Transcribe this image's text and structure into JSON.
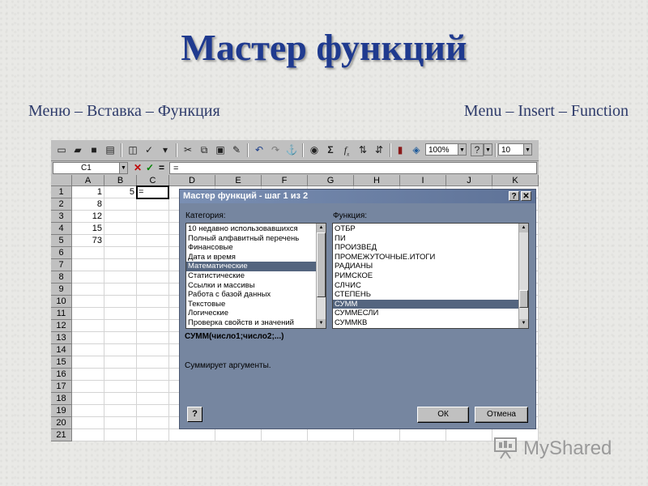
{
  "slide": {
    "title": "Мастер функций",
    "subtitle_ru": "Меню – Вставка – Функция",
    "subtitle_en": "Menu – Insert – Function"
  },
  "excel": {
    "toolbar": {
      "zoom": "100%",
      "font_size": "10",
      "icons": [
        "new-icon",
        "open-icon",
        "save-icon",
        "print-icon",
        "print-preview-icon",
        "spelling-icon",
        "cut-icon",
        "copy-icon",
        "paste-icon",
        "format-painter-icon",
        "undo-icon",
        "redo-icon",
        "hyperlink-icon",
        "autosum-icon",
        "function-icon",
        "sort-ascending-icon",
        "sort-descending-icon",
        "chart-wizard-icon",
        "map-icon",
        "drawing-icon",
        "help-icon"
      ]
    },
    "formula_bar": {
      "name_box": "C1",
      "equals": "=",
      "content": "="
    },
    "columns": [
      "A",
      "B",
      "C",
      "D",
      "E",
      "F",
      "G",
      "H",
      "I",
      "J",
      "K"
    ],
    "rows": [
      "1",
      "2",
      "3",
      "4",
      "5",
      "6",
      "7",
      "8",
      "9",
      "10",
      "11",
      "12",
      "13",
      "14",
      "15",
      "16",
      "17",
      "18",
      "19",
      "20",
      "21"
    ],
    "cells": {
      "A1": "1",
      "A2": "8",
      "A3": "12",
      "A4": "15",
      "A5": "73",
      "B1": "5",
      "C1": "="
    }
  },
  "dialog": {
    "title": "Мастер функций - шаг 1 из 2",
    "category_label": "Категория:",
    "function_label": "Функция:",
    "categories": [
      "10 недавно использовавшихся",
      "Полный алфавитный перечень",
      "Финансовые",
      "Дата и время",
      "Математические",
      "Статистические",
      "Ссылки и массивы",
      "Работа с базой данных",
      "Текстовые",
      "Логические",
      "Проверка свойств и значений"
    ],
    "selected_category": "Математические",
    "functions": [
      "ОТБР",
      "ПИ",
      "ПРОИЗВЕД",
      "ПРОМЕЖУТОЧНЫЕ.ИТОГИ",
      "РАДИАНЫ",
      "РИМСКОЕ",
      "СЛЧИС",
      "СТЕПЕНЬ",
      "СУММ",
      "СУММЕСЛИ",
      "СУММКВ"
    ],
    "selected_function": "СУММ",
    "signature": "СУММ(число1;число2;...)",
    "description": "Суммирует аргументы.",
    "ok_label": "ОК",
    "cancel_label": "Отмена",
    "help_label": "?",
    "title_help": "?",
    "title_close": "✕"
  },
  "watermark": {
    "text": "MyShared"
  }
}
